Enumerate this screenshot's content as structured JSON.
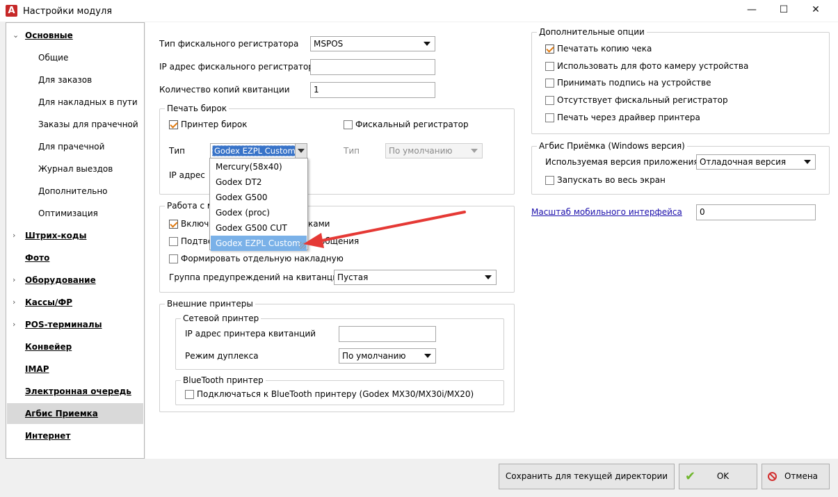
{
  "window": {
    "title": "Настройки модуля",
    "app_icon": "A",
    "minimize": "—",
    "maximize": "☐",
    "close": "✕"
  },
  "sidebar": {
    "items": [
      {
        "label": "Основные",
        "kind": "top",
        "expanded": true
      },
      {
        "label": "Общие",
        "kind": "sub"
      },
      {
        "label": "Для заказов",
        "kind": "sub"
      },
      {
        "label": "Для накладных в пути",
        "kind": "sub"
      },
      {
        "label": "Заказы для прачечной",
        "kind": "sub"
      },
      {
        "label": "Для прачечной",
        "kind": "sub"
      },
      {
        "label": "Журнал выездов",
        "kind": "sub"
      },
      {
        "label": "Дополнительно",
        "kind": "sub"
      },
      {
        "label": "Оптимизация",
        "kind": "sub"
      },
      {
        "label": "Штрих-коды",
        "kind": "top",
        "collapsed": true
      },
      {
        "label": "Фото",
        "kind": "top"
      },
      {
        "label": "Оборудование",
        "kind": "top",
        "collapsed": true
      },
      {
        "label": "Кассы/ФР",
        "kind": "top",
        "collapsed": true
      },
      {
        "label": "POS-терминалы",
        "kind": "top",
        "collapsed": true
      },
      {
        "label": "Конвейер",
        "kind": "top"
      },
      {
        "label": "IMAP",
        "kind": "top"
      },
      {
        "label": "Электронная очередь",
        "kind": "top"
      },
      {
        "label": "Агбис Приемка",
        "kind": "top",
        "selected": true
      },
      {
        "label": "Интернет",
        "kind": "top"
      }
    ]
  },
  "fiscal": {
    "type_label": "Тип фискального регистратора",
    "type_value": "MSPOS",
    "ip_label": "IP адрес фискального регистратора",
    "ip_value": "",
    "copies_label": "Количество копий квитанции",
    "copies_value": "1"
  },
  "tags": {
    "title": "Печать бирок",
    "tag_printer_label": "Принтер бирок",
    "tag_printer_checked": true,
    "fiscal_reg_label": "Фискальный регистратор",
    "fiscal_reg_checked": false,
    "type_label": "Тип",
    "type_value": "Godex EZPL Custom",
    "type2_label": "Тип",
    "type2_value": "По умолчанию",
    "ip_label": "IP адрес"
  },
  "dropdown": {
    "options": [
      "Mercury(58x40)",
      "Godex DT2",
      "Godex G500",
      "Godex (proc)",
      "Godex G500 CUT",
      "Godex EZPL Custom"
    ],
    "highlighted": "Godex EZPL Custom"
  },
  "work": {
    "title": "Работа с ме",
    "opt1": "Включи",
    "opt1_tail": "ками",
    "opt1_checked": true,
    "opt2": "Подтвер",
    "opt2_tail": "сообщения",
    "opt2_checked": false,
    "opt3": "Формировать отдельную накладную",
    "opt3_checked": false,
    "warn_label": "Группа предупреждений на квитанции",
    "warn_value": "Пустая"
  },
  "ext": {
    "title": "Внешние принтеры",
    "net_title": "Сетевой принтер",
    "net_ip_label": "IP адрес принтера квитанций",
    "net_ip_value": "",
    "duplex_label": "Режим дуплекса",
    "duplex_value": "По умолчанию",
    "bt_title": "BlueTooth принтер",
    "bt_label": "Подключаться к BlueTooth принтеру (Godex MX30/MX30i/MX20)",
    "bt_checked": false
  },
  "extra": {
    "title": "Дополнительные опции",
    "items": [
      {
        "label": "Печатать копию чека",
        "checked": true
      },
      {
        "label": "Использовать для фото камеру устройства",
        "checked": false
      },
      {
        "label": "Принимать подпись на устройстве",
        "checked": false
      },
      {
        "label": "Отсутствует фискальный регистратор",
        "checked": false
      },
      {
        "label": "Печать через драйвер принтера",
        "checked": false
      }
    ]
  },
  "agbis": {
    "title": "Агбис Приёмка (Windows версия)",
    "version_label": "Используемая версия приложения",
    "version_value": "Отладочная версия",
    "fullscreen_label": "Запускать во весь экран",
    "fullscreen_checked": false
  },
  "scale": {
    "label": "Масштаб мобильного интерфейса",
    "value": "0"
  },
  "buttons": {
    "save": "Сохранить для текущей директории",
    "ok": "OK",
    "cancel": "Отмена"
  },
  "colors": {
    "accent": "#e07a10",
    "highlight": "#7ab1e8",
    "arrow": "#e53935",
    "selected": "#d9d9d9"
  }
}
